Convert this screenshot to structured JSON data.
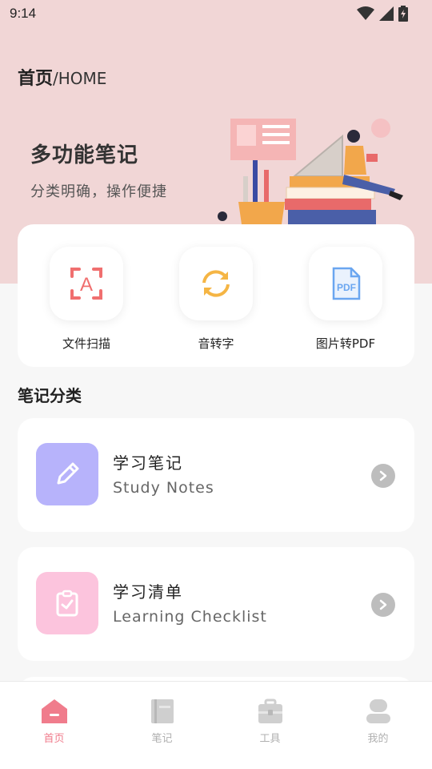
{
  "status": {
    "time": "9:14"
  },
  "header": {
    "title": "首页",
    "subtitle": "/HOME"
  },
  "banner": {
    "title": "多功能笔记",
    "subtitle": "分类明确，操作便捷"
  },
  "tools": [
    {
      "label": "文件扫描",
      "icon": "scan-text-icon"
    },
    {
      "label": "音转字",
      "icon": "refresh-convert-icon"
    },
    {
      "label": "图片转PDF",
      "icon": "pdf-file-icon"
    }
  ],
  "notes_section": {
    "title": "笔记分类",
    "items": [
      {
        "title": "学习笔记",
        "subtitle": "Study Notes",
        "icon": "pencil-icon",
        "color": "#b7b3fb"
      },
      {
        "title": "学习清单",
        "subtitle": "Learning Checklist",
        "icon": "clipboard-check-icon",
        "color": "#fcc4dd"
      }
    ]
  },
  "tabbar": [
    {
      "label": "首页",
      "icon": "home-icon",
      "active": true
    },
    {
      "label": "笔记",
      "icon": "notebook-icon",
      "active": false
    },
    {
      "label": "工具",
      "icon": "toolbox-icon",
      "active": false
    },
    {
      "label": "我的",
      "icon": "user-icon",
      "active": false
    }
  ],
  "colors": {
    "hero_bg": "#f1d6d6",
    "accent": "#f07c8c",
    "scan_icon": "#f06f6f",
    "convert_icon": "#f5b544",
    "pdf_icon": "#6aa6f0"
  }
}
